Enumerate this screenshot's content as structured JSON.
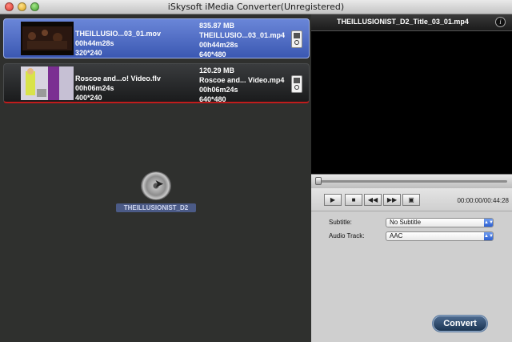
{
  "window": {
    "title": "iSkysoft iMedia Converter(Unregistered)"
  },
  "files": [
    {
      "name": "THEILLUSIO...03_01.mov",
      "duration": "00h44m28s",
      "resolution": "320*240",
      "out_size": "835.87 MB",
      "out_name": "THEILLUSIO...03_01.mp4",
      "out_duration": "00h44m28s",
      "out_resolution": "640*480",
      "selected": true
    },
    {
      "name": "Roscoe and...o! Video.flv",
      "duration": "00h06m24s",
      "resolution": "400*240",
      "out_size": "120.29 MB",
      "out_name": "Roscoe and... Video.mp4",
      "out_duration": "00h06m24s",
      "out_resolution": "640*480",
      "selected": false
    }
  ],
  "dragged_disc": {
    "label": "THEILLUSIONIST_D2",
    "icon": "dvd-disc-icon"
  },
  "preview": {
    "title": "THEILLUSIONIST_D2_Title_03_01.mp4",
    "info_icon": "i",
    "timecode": "00:00:00/00:44:28",
    "progress": 0
  },
  "settings": {
    "subtitle_label": "Subtitle:",
    "subtitle_value": "No Subtitle",
    "audio_label": "Audio Track:",
    "audio_value": "AAC"
  },
  "buttons": {
    "convert": "Convert"
  },
  "colors": {
    "selected_item": "#4b67c4",
    "accent_red": "#c01c1c"
  }
}
